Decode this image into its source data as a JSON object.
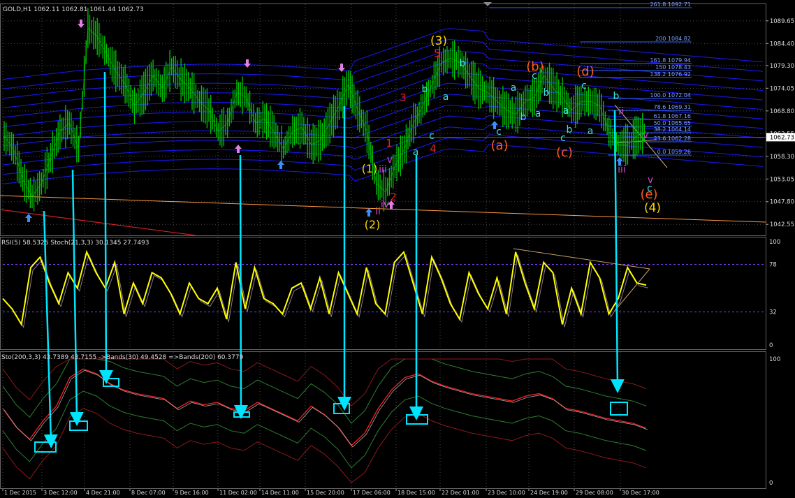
{
  "main_header": "GOLD,H1  1062.11 1062.81 1061.44 1062.73",
  "rsi_header": "RSI(5) 58.5325  Stoch(21,3,3) 30.1345 27.7493",
  "sto_header": "Sto(200,3,3) 43.7389 43.7155  ->Bands(30) 49.4528  =>Bands(200) 60.3779",
  "price_axis": {
    "ticks": [
      "1089.65",
      "1084.40",
      "1079.30",
      "1074.05",
      "1068.80",
      "1063.55",
      "1058.30",
      "1053.05",
      "1047.80",
      "1042.55"
    ],
    "current_price": "1062.73"
  },
  "rsi_axis": {
    "ticks": [
      "100",
      "78",
      "32",
      "0"
    ]
  },
  "sto_axis": {
    "ticks": [
      "100",
      "0"
    ]
  },
  "time_axis": [
    "1 Dec 2015",
    "3 Dec 12:00",
    "4 Dec 21:00",
    "8 Dec 07:00",
    "9 Dec 16:00",
    "11 Dec 02:00",
    "14 Dec 11:00",
    "15 Dec 20:00",
    "17 Dec 06:00",
    "18 Dec 15:00",
    "22 Dec 01:00",
    "23 Dec 10:00",
    "24 Dec 19:00",
    "29 Dec 08:00",
    "30 Dec 17:00"
  ],
  "fib_levels": [
    {
      "label": "261.8 1092.71"
    },
    {
      "label": "200 1084.82"
    },
    {
      "label": "161.8 1079.94"
    },
    {
      "label": "150 1078.43"
    },
    {
      "label": "138.2 1076.92"
    },
    {
      "label": "100.0 1072.04"
    },
    {
      "label": "78.6 1069.31"
    },
    {
      "label": "61.8 1067.16"
    },
    {
      "label": "50.0 1065.65"
    },
    {
      "label": "38.2 1064.14"
    },
    {
      "label": "23.6 1062.28"
    },
    {
      "label": "0.0 1059.26"
    }
  ],
  "wave_labels": {
    "w3_major": "(3)",
    "w5": "5",
    "w3_red": "3",
    "w4_red": "4",
    "w1_red": "1",
    "w2_red": "2",
    "w1_paren": "(1)",
    "w2_paren": "(2)",
    "wa": "(a)",
    "wb": "(b)",
    "wc": "(c)",
    "wd": "(d)",
    "we": "(e)",
    "w4_major": "(4)",
    "a": "a",
    "b": "b",
    "c": "c",
    "ii": "ii",
    "iii": "iii",
    "iv": "iv",
    "v": "v"
  },
  "colors": {
    "price_bars": "#00c800",
    "bands": "#1a1aff",
    "rsi": "#ffff00",
    "sto_red": "#ff2020",
    "arrows": "#00e5ff",
    "grid": "#4a4a4a",
    "fib": "#3366ff",
    "orange": "#ff5a1e",
    "yellow": "#ffd700",
    "magenta": "#cc44cc"
  },
  "chart_data": [
    {
      "type": "line",
      "title": "GOLD,H1",
      "ylabel": "",
      "ylim": [
        1040.0,
        1093.5
      ],
      "series": [
        {
          "name": "GOLD",
          "values": [
            1063,
            1060,
            1053,
            1049,
            1052,
            1058,
            1064,
            1066,
            1060,
            1088,
            1086,
            1082,
            1078,
            1075,
            1070,
            1073,
            1077,
            1074,
            1079,
            1076,
            1074,
            1071,
            1069,
            1064,
            1066,
            1073,
            1072,
            1066,
            1067,
            1064,
            1060,
            1064,
            1065,
            1061,
            1062,
            1066,
            1070,
            1075,
            1069,
            1064,
            1052,
            1050,
            1056,
            1060,
            1066,
            1070,
            1075,
            1080,
            1081,
            1080,
            1077,
            1074,
            1073,
            1071,
            1069,
            1068,
            1071,
            1072,
            1077,
            1074,
            1072,
            1069,
            1071,
            1071,
            1070,
            1064,
            1061,
            1061,
            1063,
            1064
          ]
        }
      ]
    },
    {
      "type": "line",
      "title": "RSI(5) 58.5325  Stoch(21,3,3) 30.1345 27.7493",
      "ylim": [
        0,
        100
      ],
      "series": [
        {
          "name": "RSI(5)",
          "values": [
            45,
            35,
            20,
            75,
            85,
            60,
            40,
            70,
            55,
            90,
            70,
            55,
            80,
            30,
            60,
            40,
            70,
            65,
            50,
            30,
            60,
            45,
            40,
            55,
            25,
            80,
            35,
            75,
            45,
            40,
            30,
            55,
            60,
            35,
            65,
            30,
            70,
            50,
            30,
            75,
            40,
            30,
            80,
            90,
            60,
            30,
            85,
            65,
            40,
            25,
            70,
            50,
            35,
            65,
            30,
            90,
            60,
            35,
            80,
            70,
            20,
            55,
            30,
            80,
            65,
            30,
            45,
            75,
            60,
            58
          ]
        }
      ]
    },
    {
      "type": "line",
      "title": "Sto(200,3,3) 43.7389 43.7155",
      "ylim": [
        0,
        100
      ],
      "series": [
        {
          "name": "Sto(200,3,3)",
          "values": [
            60,
            45,
            35,
            50,
            62,
            85,
            92,
            88,
            80,
            75,
            72,
            70,
            68,
            60,
            66,
            63,
            65,
            60,
            58,
            65,
            60,
            55,
            50,
            62,
            55,
            45,
            30,
            40,
            60,
            75,
            85,
            88,
            82,
            78,
            75,
            72,
            70,
            68,
            66,
            70,
            72,
            68,
            60,
            58,
            55,
            52,
            50,
            48,
            44
          ]
        }
      ]
    }
  ]
}
